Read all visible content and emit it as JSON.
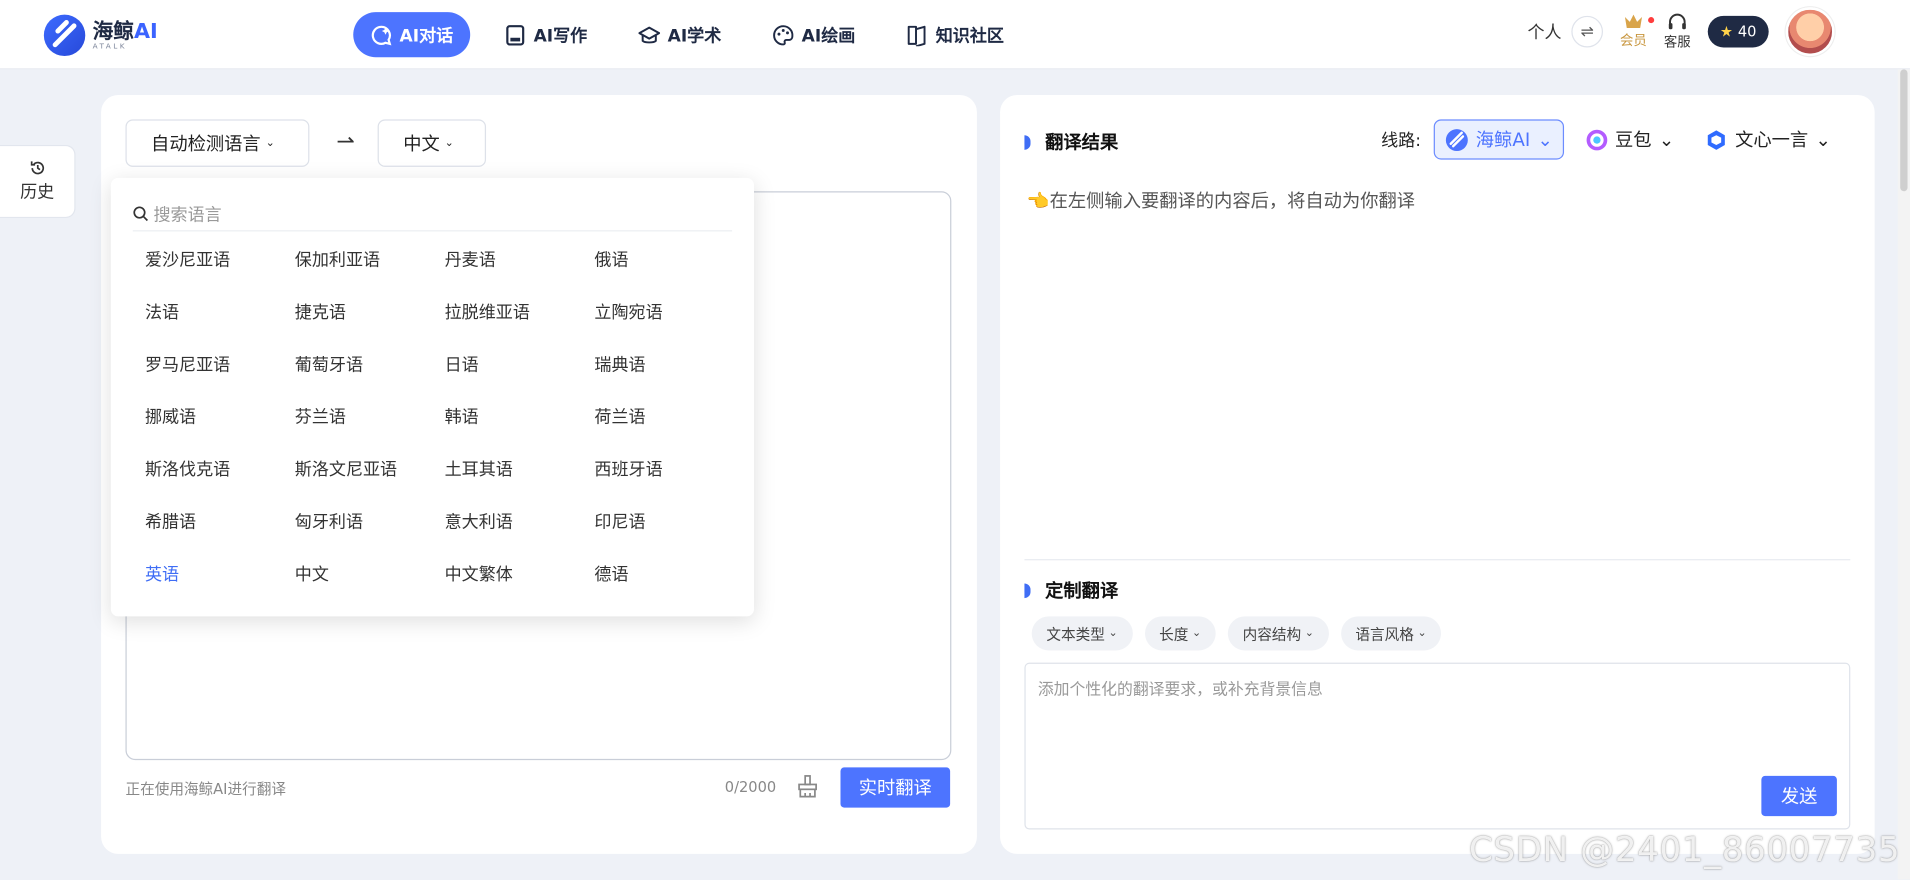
{
  "brand": {
    "name": "海鲸",
    "ai": "AI",
    "sub": "ATALK",
    "accent": "#4d74ff"
  },
  "nav": [
    {
      "label": "AI对话",
      "icon": "chat-icon",
      "active": true
    },
    {
      "label": "AI写作",
      "icon": "write-icon"
    },
    {
      "label": "AI学术",
      "icon": "graduation-cap-icon"
    },
    {
      "label": "AI绘画",
      "icon": "palette-icon"
    },
    {
      "label": "知识社区",
      "icon": "book-icon"
    }
  ],
  "topRight": {
    "personal": "个人",
    "swap": "⇌",
    "vip": "会员",
    "service": "客服",
    "points": "40"
  },
  "history": {
    "label": "历史"
  },
  "translator": {
    "sourceLang": "自动检测语言",
    "targetLang": "中文",
    "usingModel": "正在使用海鲸AI进行翻译",
    "charCount": "0/2000",
    "realtimeButton": "实时翻译"
  },
  "dropdown": {
    "searchPlaceholder": "搜索语言",
    "languages": [
      "爱沙尼亚语",
      "保加利亚语",
      "丹麦语",
      "俄语",
      "法语",
      "捷克语",
      "拉脱维亚语",
      "立陶宛语",
      "罗马尼亚语",
      "葡萄牙语",
      "日语",
      "瑞典语",
      "挪威语",
      "芬兰语",
      "韩语",
      "荷兰语",
      "斯洛伐克语",
      "斯洛文尼亚语",
      "土耳其语",
      "西班牙语",
      "希腊语",
      "匈牙利语",
      "意大利语",
      "印尼语",
      "英语",
      "中文",
      "中文繁体",
      "德语"
    ],
    "selected": "英语"
  },
  "result": {
    "title": "翻译结果",
    "routeLabel": "线路:",
    "models": [
      {
        "label": "海鲸AI",
        "active": true
      },
      {
        "label": "豆包"
      },
      {
        "label": "文心一言"
      }
    ],
    "hint": "👈在左侧输入要翻译的内容后，将自动为你翻译"
  },
  "custom": {
    "title": "定制翻译",
    "chips": [
      "文本类型",
      "长度",
      "内容结构",
      "语言风格"
    ],
    "placeholder": "添加个性化的翻译要求，或补充背景信息",
    "sendButton": "发送"
  },
  "watermark": "CSDN @2401_86007735"
}
